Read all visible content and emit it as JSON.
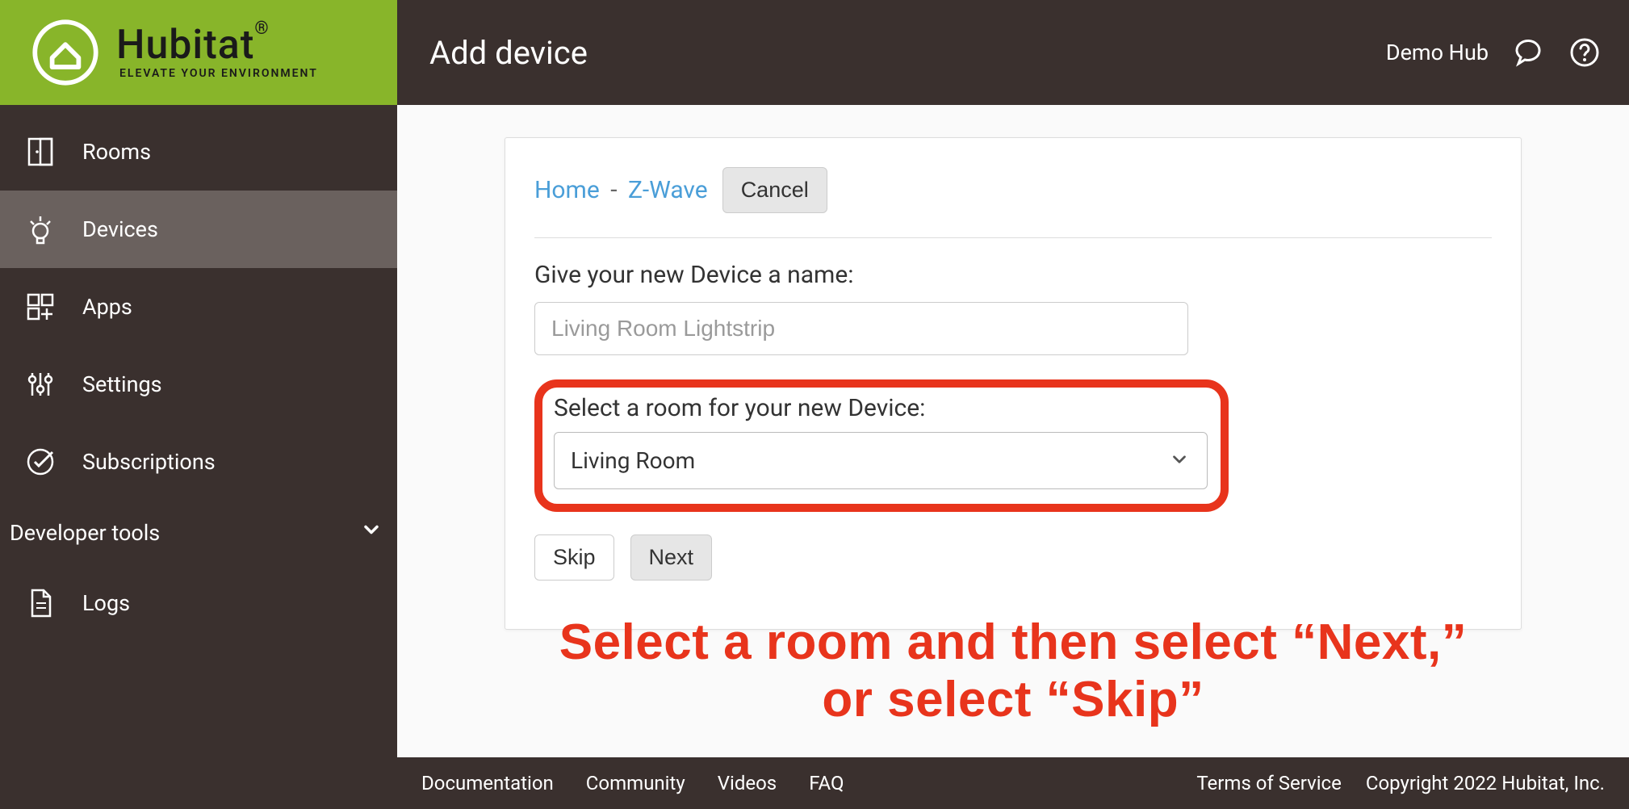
{
  "brand": {
    "name": "Hubitat",
    "tagline": "ELEVATE YOUR ENVIRONMENT",
    "reg": "®"
  },
  "sidebar": {
    "items": [
      {
        "label": "Rooms"
      },
      {
        "label": "Devices"
      },
      {
        "label": "Apps"
      },
      {
        "label": "Settings"
      },
      {
        "label": "Subscriptions"
      }
    ],
    "dev_section": "Developer tools",
    "logs": "Logs"
  },
  "header": {
    "title": "Add device",
    "hub_name": "Demo Hub"
  },
  "breadcrumb": {
    "home": "Home",
    "sep": "-",
    "zwave": "Z-Wave"
  },
  "buttons": {
    "cancel": "Cancel",
    "skip": "Skip",
    "next": "Next"
  },
  "form": {
    "name_label": "Give your new Device a name:",
    "name_placeholder": "Living Room Lightstrip",
    "room_label": "Select a room for your new Device:",
    "room_value": "Living Room"
  },
  "annotation": {
    "line1": "Select a room and then select “Next,”",
    "line2": "or select “Skip”"
  },
  "footer": {
    "links": [
      "Documentation",
      "Community",
      "Videos",
      "FAQ"
    ],
    "tos": "Terms of Service",
    "copyright": "Copyright 2022 Hubitat, Inc."
  }
}
